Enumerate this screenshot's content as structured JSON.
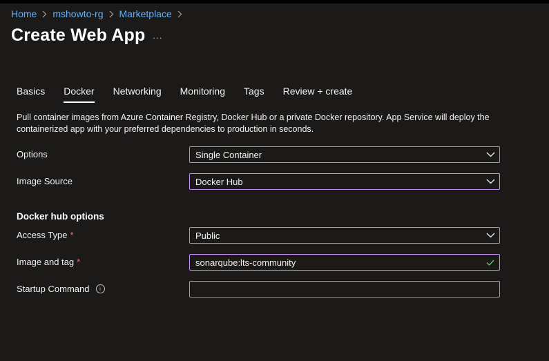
{
  "breadcrumb": [
    {
      "label": "Home"
    },
    {
      "label": "mshowto-rg"
    },
    {
      "label": "Marketplace"
    }
  ],
  "page": {
    "title": "Create Web App",
    "more": "..."
  },
  "tabs": [
    {
      "label": "Basics",
      "active": false
    },
    {
      "label": "Docker",
      "active": true
    },
    {
      "label": "Networking",
      "active": false
    },
    {
      "label": "Monitoring",
      "active": false
    },
    {
      "label": "Tags",
      "active": false
    },
    {
      "label": "Review + create",
      "active": false
    }
  ],
  "description": "Pull container images from Azure Container Registry, Docker Hub or a private Docker repository. App Service will deploy the containerized app with your preferred dependencies to production in seconds.",
  "form": {
    "options": {
      "label": "Options",
      "value": "Single Container"
    },
    "image_source": {
      "label": "Image Source",
      "value": "Docker Hub"
    },
    "section_title": "Docker hub options",
    "access_type": {
      "label": "Access Type",
      "required": "*",
      "value": "Public"
    },
    "image_tag": {
      "label": "Image and tag",
      "required": "*",
      "value": "sonarqube:lts-community"
    },
    "startup_command": {
      "label": "Startup Command",
      "info": "i",
      "value": ""
    }
  },
  "colors": {
    "background": "#1b1a19",
    "link": "#6ab0f5",
    "focus_border": "#c890ff",
    "required": "#f1707b",
    "valid_check": "#6ccb5f"
  },
  "icons": {
    "breadcrumb_separator": "chevron-right-icon",
    "dropdown": "chevron-down-icon",
    "valid": "checkmark-icon",
    "info": "info-icon"
  }
}
